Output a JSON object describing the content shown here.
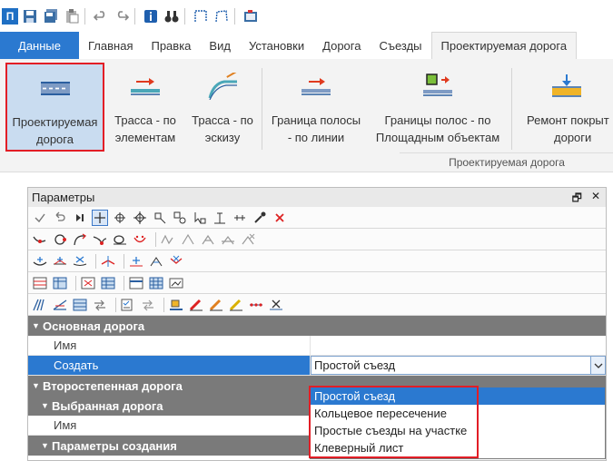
{
  "quick_access": {
    "icons": [
      "app-logo",
      "save-icon",
      "save-all-icon",
      "paste-icon",
      "undo-icon",
      "redo-icon",
      "info-icon",
      "binoculars-icon",
      "frame-icon",
      "polyline-icon",
      "screenshot-icon"
    ]
  },
  "app_logo_letter": "П",
  "tabs": [
    {
      "label": "Данные",
      "kind": "file"
    },
    {
      "label": "Главная"
    },
    {
      "label": "Правка"
    },
    {
      "label": "Вид"
    },
    {
      "label": "Установки"
    },
    {
      "label": "Дорога"
    },
    {
      "label": "Съезды"
    },
    {
      "label": "Проектируемая дорога",
      "active": true
    }
  ],
  "ribbon": {
    "buttons": [
      {
        "line1": "Проектируемая",
        "line2": "дорога",
        "selected": true
      },
      {
        "line1": "Трасса - по",
        "line2": "элементам"
      },
      {
        "line1": "Трасса - по",
        "line2": "эскизу"
      },
      {
        "line1": "Граница полосы",
        "line2": "- по линии"
      },
      {
        "line1": "Границы полос - по",
        "line2": "Площадным объектам"
      },
      {
        "line1": "Ремонт покрыт",
        "line2": "дороги"
      }
    ],
    "group_label": "Проектируемая дорога"
  },
  "panel": {
    "title": "Параметры",
    "pin_glyph": "🗗",
    "close_glyph": "✕",
    "groups": {
      "main_road": "Основная дорога",
      "secondary_road": "Второстепенная дорога",
      "selected_road": "Выбранная дорога",
      "creation_params": "Параметры создания"
    },
    "props": {
      "name_label": "Имя",
      "create_label": "Создать",
      "create_value": "Простой съезд",
      "sub_name_label": "Имя"
    }
  },
  "dropdown": {
    "options": [
      "Простой съезд",
      "Кольцевое пересечение",
      "Простые съезды на участке",
      "Клеверный лист"
    ],
    "selected_index": 0
  },
  "colors": {
    "accent": "#2b79d0",
    "highlight_red": "#e21e26",
    "group_header": "#7a7a7a"
  }
}
